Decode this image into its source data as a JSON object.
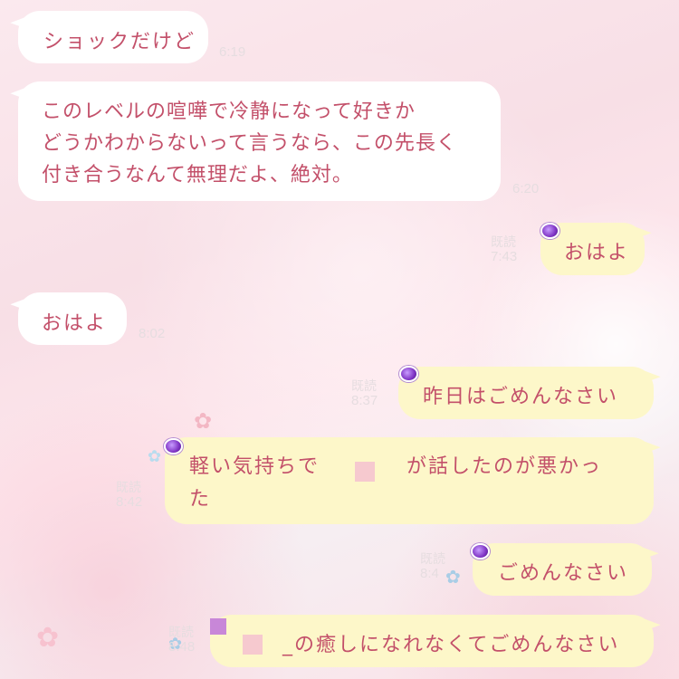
{
  "messages": [
    {
      "text": "ショックだけど",
      "time": "6:19"
    },
    {
      "line1": "このレベルの喧嘩で冷静になって好きか",
      "line2": "どうかわからないって言うなら、この先長く",
      "line3": "付き合うなんて無理だよ、絶対。",
      "time": "6:20"
    },
    {
      "text": "おはよ",
      "read": "既読",
      "time": "7:43"
    },
    {
      "text": "おはよ",
      "time": "8:02"
    },
    {
      "text": "昨日はごめんなさい",
      "read": "既読",
      "time": "8:37"
    },
    {
      "line1a": "軽い気持ちで",
      "line1b": "が話したのが悪かっ",
      "line2": "た",
      "read": "既読",
      "time": "8:42"
    },
    {
      "text": "ごめんなさい",
      "read": "既読",
      "time": "8:4"
    },
    {
      "text": "_の癒しになれなくてごめんなさい",
      "read": "既読",
      "time": "8:48"
    }
  ],
  "icons": {
    "flower": "flower-icon",
    "gem": "gem-sticker-icon"
  },
  "colors": {
    "text": "#c3506a",
    "incoming_bubble": "#ffffff",
    "outgoing_bubble": "#fdf7c9",
    "timestamp": "#e6dde0"
  }
}
